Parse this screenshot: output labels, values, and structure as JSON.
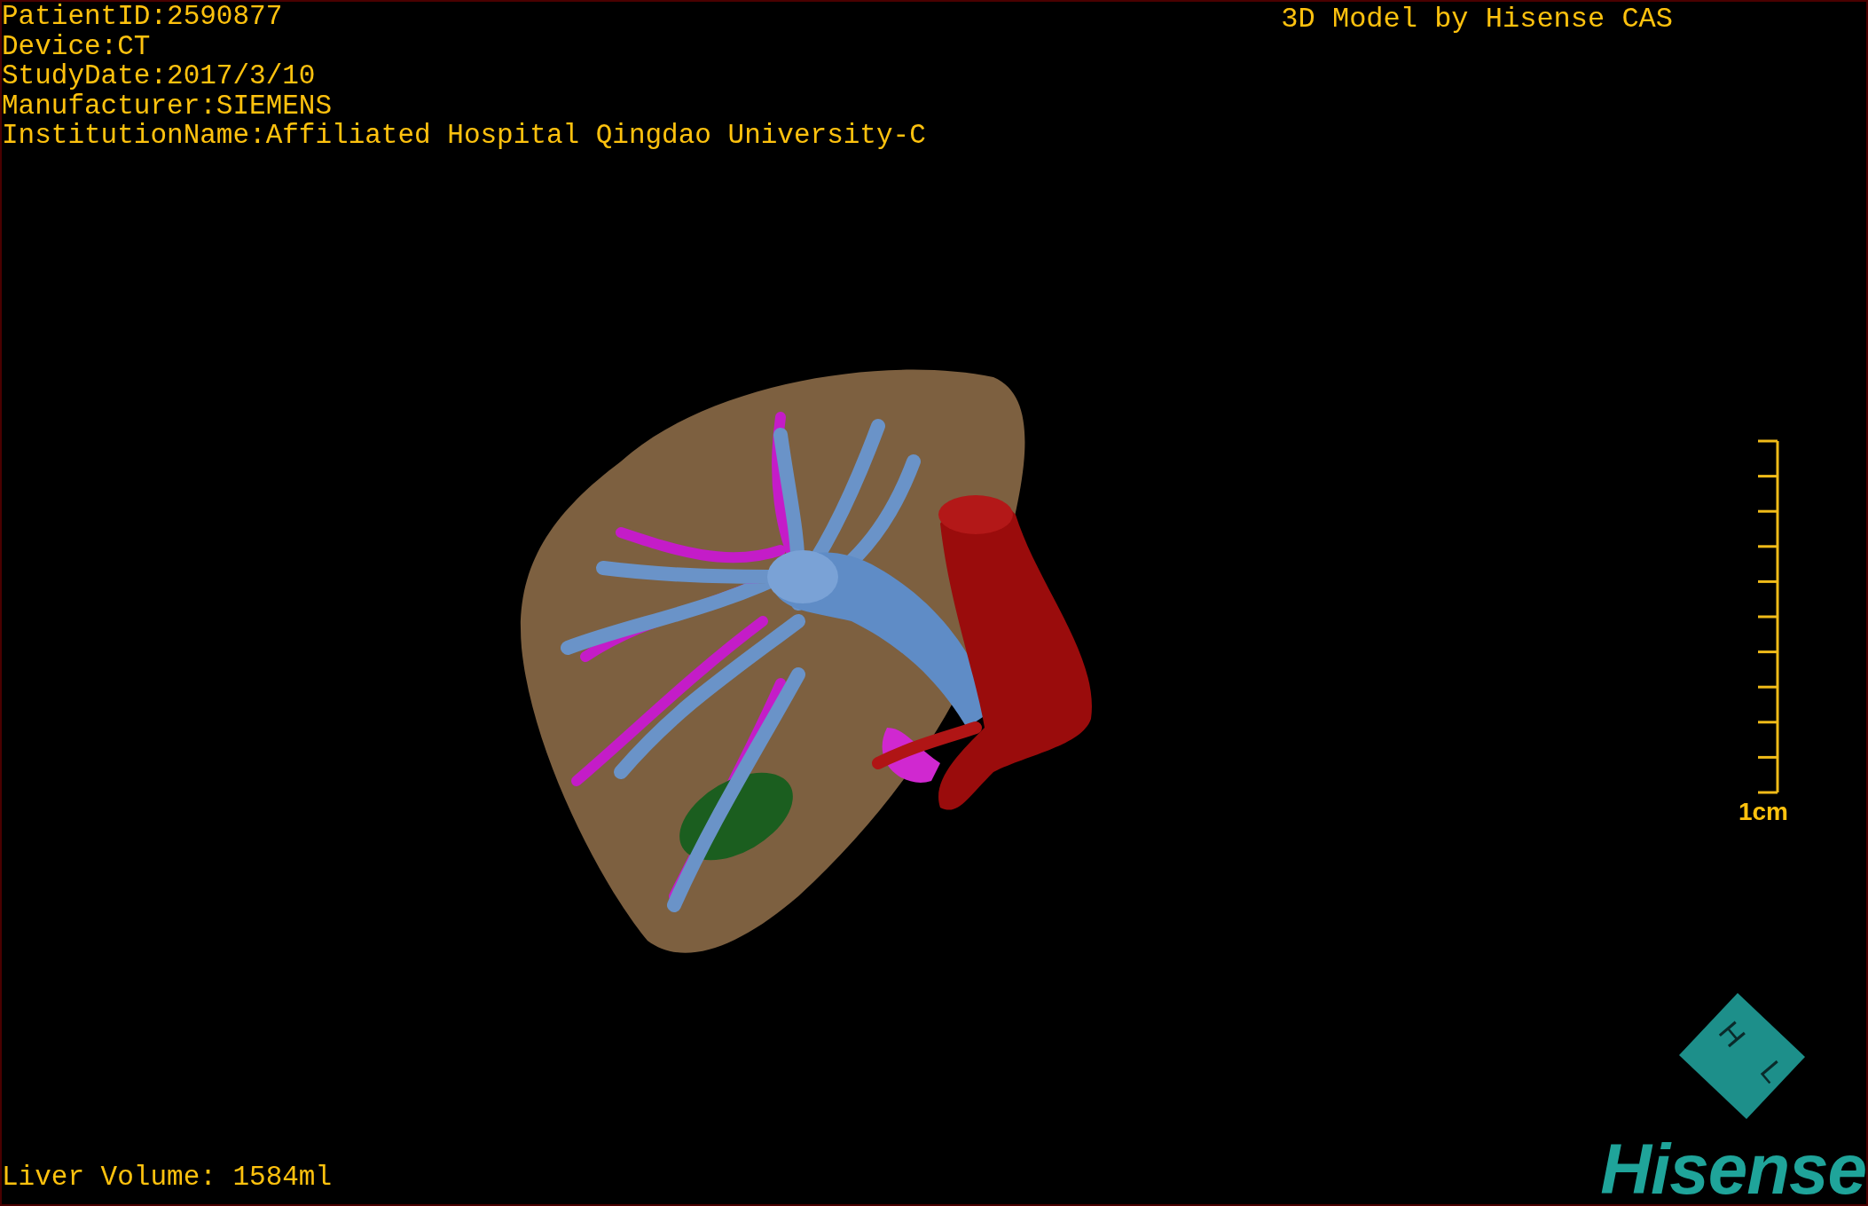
{
  "info_lines": [
    "PatientID:2590877",
    "Device:CT",
    "StudyDate:2017/3/10",
    "Manufacturer:SIEMENS",
    "InstitutionName:Affiliated Hospital Qingdao University-C"
  ],
  "title": "3D Model by Hisense CAS",
  "scale_bar": {
    "label": "1cm"
  },
  "liver_volume": "Liver Volume: 1584ml",
  "orientation_cube": {
    "labels": [
      "H",
      "L"
    ]
  },
  "logo": {
    "text": "Hisense"
  }
}
